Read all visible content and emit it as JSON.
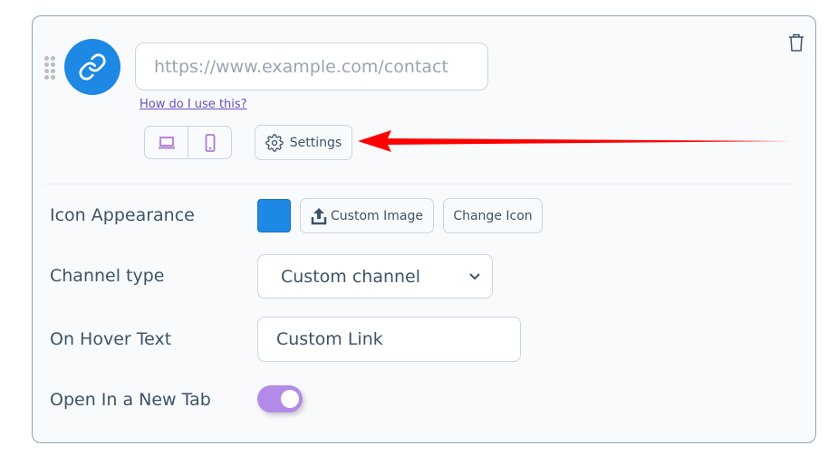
{
  "channel": {
    "url_placeholder": "https://www.example.com/contact",
    "url_value": "",
    "help_link": "How do I use this?",
    "settings_label": "Settings",
    "icons": {
      "drag": "drag-handle-icon",
      "channel": "link-icon",
      "desktop": "laptop-icon",
      "mobile": "mobile-phone-icon",
      "settings": "gear-icon",
      "delete": "trash-icon",
      "upload": "upload-icon",
      "dropdown": "chevron-down-icon"
    }
  },
  "fields": {
    "icon_appearance": {
      "label": "Icon Appearance",
      "color": "#1e88e5",
      "custom_image_label": "Custom Image",
      "change_icon_label": "Change Icon"
    },
    "channel_type": {
      "label": "Channel type",
      "selected": "Custom channel"
    },
    "hover_text": {
      "label": "On Hover Text",
      "value": "Custom Link"
    },
    "new_tab": {
      "label": "Open In a New Tab",
      "enabled": true
    }
  },
  "colors": {
    "accent": "#1e88e5",
    "device_icon": "#b07ad6",
    "toggle_on": "#b48ae8",
    "annotation_arrow": "#ff0000"
  }
}
